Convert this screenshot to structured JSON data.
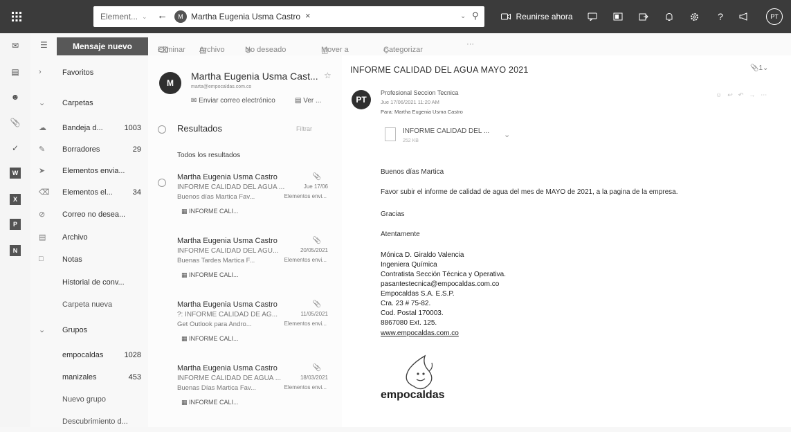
{
  "topbar": {
    "search_scope": "Element...",
    "search_contact": "Martha Eugenia Usma Castro",
    "meet_now": "Reunirse ahora",
    "avatar_initials": "PT"
  },
  "nav": {
    "new_message": "Mensaje nuevo",
    "items": [
      {
        "label": "Favoritos",
        "count": ""
      },
      {
        "label": "Carpetas",
        "count": ""
      },
      {
        "label": "Bandeja d...",
        "count": "1003"
      },
      {
        "label": "Borradores",
        "count": "29"
      },
      {
        "label": "Elementos envia...",
        "count": ""
      },
      {
        "label": "Elementos el...",
        "count": "34"
      },
      {
        "label": "Correo no desea...",
        "count": ""
      },
      {
        "label": "Archivo",
        "count": ""
      },
      {
        "label": "Notas",
        "count": ""
      },
      {
        "label": "Historial de conv...",
        "count": ""
      },
      {
        "label": "Carpeta nueva",
        "count": ""
      },
      {
        "label": "Grupos",
        "count": ""
      },
      {
        "label": "empocaldas",
        "count": "1028"
      },
      {
        "label": "manizales",
        "count": "453"
      },
      {
        "label": "Nuevo grupo",
        "count": ""
      },
      {
        "label": "Descubrimiento d...",
        "count": ""
      }
    ]
  },
  "toolbar": {
    "delete": "Eliminar",
    "archive": "Archivo",
    "junk": "No deseado",
    "move": "Mover a",
    "categorize": "Categorizar"
  },
  "contact": {
    "initial": "M",
    "name": "Martha Eugenia Usma Cast...",
    "email": "marta@empocaldas.com.co",
    "send_email": "Enviar correo electrónico",
    "view": "Ver ..."
  },
  "results": {
    "title": "Resultados",
    "filter": "Filtrar",
    "all_results": "Todos los resultados"
  },
  "messages": [
    {
      "sender": "Martha Eugenia Usma Castro",
      "subject": "INFORME CALIDAD DEL AGUA ...",
      "date": "Jue 17/06",
      "preview": "Buenos días Martica Fav...",
      "folder": "Elementos envi...",
      "attachment": "INFORME CALI..."
    },
    {
      "sender": "Martha Eugenia Usma Castro",
      "subject": "INFORME CALIDAD DEL AGU...",
      "date": "20/05/2021",
      "preview": "Buenas Tardes Martica F...",
      "folder": "Elementos envi...",
      "attachment": "INFORME CALI..."
    },
    {
      "sender": "Martha Eugenia Usma Castro",
      "subject": "?: INFORME CALIDAD DE AG...",
      "date": "11/05/2021",
      "preview": "Get Outlook para Andro...",
      "folder": "Elementos envi...",
      "attachment": "INFORME CALI..."
    },
    {
      "sender": "Martha Eugenia Usma Castro",
      "subject": "INFORME CALIDAD DE AGUA ...",
      "date": "18/03/2021",
      "preview": "Buenas Días Martica Fav...",
      "folder": "Elementos envi...",
      "attachment": "INFORME CALI..."
    }
  ],
  "reading": {
    "subject": "INFORME CALIDAD DEL AGUA MAYO 2021",
    "from_initials": "PT",
    "from_name": "Profesional Seccion Tecnica",
    "date": "Jue 17/06/2021 11:20 AM",
    "to": "Para: Martha Eugenia Usma Castro",
    "attachment_name": "INFORME CALIDAD DEL ...",
    "attachment_size": "252 KB",
    "greeting": "Buenos días Martica",
    "body": "Favor subir el informe de calidad de agua del mes de MAYO de 2021, a la pagina de la empresa.",
    "thanks": "Gracias",
    "closing": "Atentamente",
    "signature": [
      "Mónica D. Giraldo Valencia",
      "Ingeniera Química",
      "Contratista Sección Técnica y Operativa.",
      "pasantestecnica@empocaldas.com.co",
      "Empocaldas S.A. E.S.P.",
      "Cra. 23 # 75-82.",
      "Cod. Postal 170003.",
      "8867080 Ext. 125."
    ],
    "website": "www.empocaldas.com.co",
    "logo_text": "empocaldas",
    "count": "1"
  }
}
